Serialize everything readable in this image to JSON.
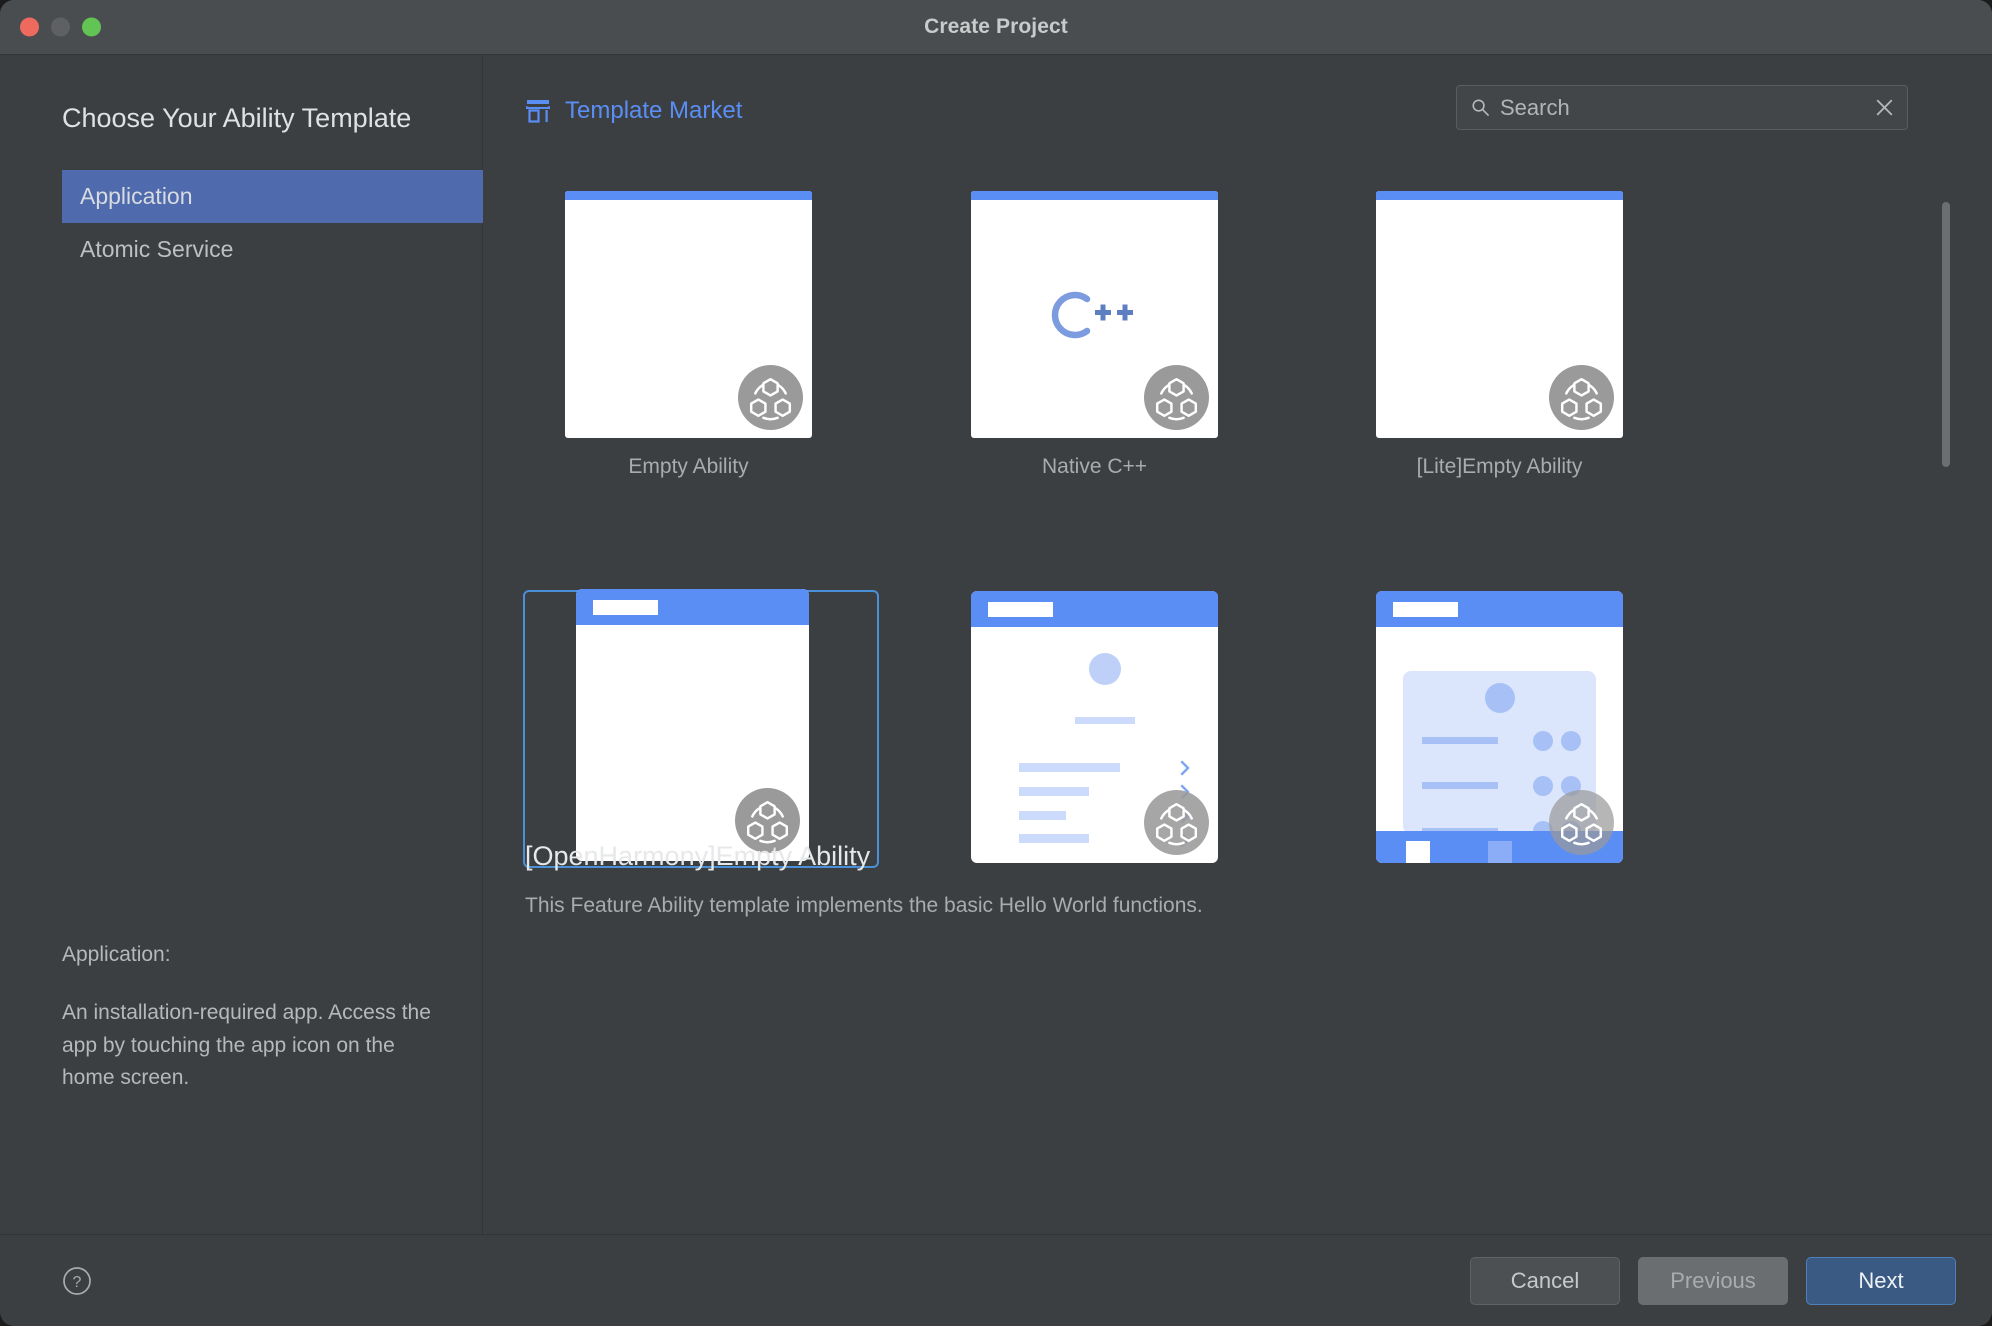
{
  "window": {
    "title": "Create Project",
    "traffic_lights": [
      "close-button",
      "minimize-button",
      "maximize-button"
    ]
  },
  "sidebar": {
    "heading": "Choose Your Ability Template",
    "items": [
      {
        "label": "Application",
        "selected": true
      },
      {
        "label": "Atomic Service",
        "selected": false
      }
    ],
    "description": {
      "title": "Application:",
      "text": "An installation-required app. Access the app by touching the app icon on the home screen."
    }
  },
  "main": {
    "market_link": "Template Market",
    "market_icon": "store-icon",
    "search": {
      "placeholder": "Search",
      "value": "",
      "icon": "search-icon",
      "clear_icon": "close-icon"
    },
    "cards": [
      {
        "label": "Empty Ability",
        "kind": "blank",
        "selected": false
      },
      {
        "label": "Native C++",
        "kind": "cpp",
        "selected": false
      },
      {
        "label": "[Lite]Empty Ability",
        "kind": "blank",
        "selected": false
      },
      {
        "label": "[OpenHarmony]Empty Ability",
        "kind": "phone-blank",
        "selected": true
      },
      {
        "label": "",
        "kind": "phone-list",
        "selected": false
      },
      {
        "label": "",
        "kind": "phone-tabs",
        "selected": false
      }
    ],
    "selection": {
      "title": "[OpenHarmony]Empty Ability",
      "description": "This Feature Ability template implements the basic Hello World functions."
    }
  },
  "footer": {
    "help_icon": "help-circle-icon",
    "buttons": [
      {
        "label": "Cancel",
        "style": "cancel"
      },
      {
        "label": "Previous",
        "style": "previous"
      },
      {
        "label": "Next",
        "style": "next"
      }
    ]
  },
  "colors": {
    "window_bg": "#3c3f41",
    "titlebar_bg": "#4a4d4f",
    "accent_blue": "#5b8ef5",
    "selection_blue": "#4f6bad",
    "next_button": "#3a5a84",
    "close_red": "#ee6a5f",
    "maximize_green": "#61c454",
    "badge_gray": "#9a9a9a"
  }
}
